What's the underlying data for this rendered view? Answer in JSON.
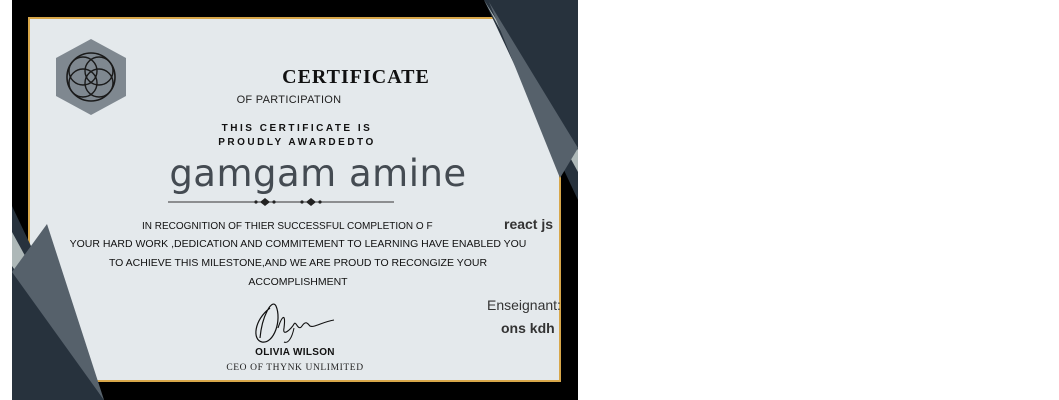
{
  "certificate": {
    "title": "CERTIFICATE",
    "subtitle": "OF PARTICIPATION",
    "awarded_line1": "THIS CERTIFICATE IS",
    "awarded_line2": "PROUDLY AWARDEDTO",
    "recipient": "gamgam amine",
    "recognition": "IN RECOGNITION OF THIER SUCCESSFUL COMPLETION O F",
    "course": "react js",
    "body_line1": "YOUR HARD WORK ,DEDICATION AND COMMITEMENT TO LEARNING HAVE ENABLED YOU",
    "body_line2": "TO ACHIEVE THIS MILESTONE,AND WE ARE PROUD TO RECONGIZE YOUR",
    "body_line3": "ACCOMPLISHMENT",
    "signer_name": "OLIVIA WILSON",
    "signer_title": "CEO OF THYNK UNLIMITED",
    "teacher_label": "Enseignant:",
    "teacher_name": "ons kdh"
  },
  "icons": {
    "seal": "hexagon-circles-seal-icon",
    "divider": "ornamental-divider",
    "signature": "handwritten-signature"
  },
  "colors": {
    "paper": "#e4e9ec",
    "border": "#d8a74a",
    "frame": "#000000",
    "dark_shard": "#27323d",
    "grey_shard": "#56616b",
    "light_shard": "#aeb8b8",
    "seal": "#7f8890",
    "name": "#444b52"
  }
}
